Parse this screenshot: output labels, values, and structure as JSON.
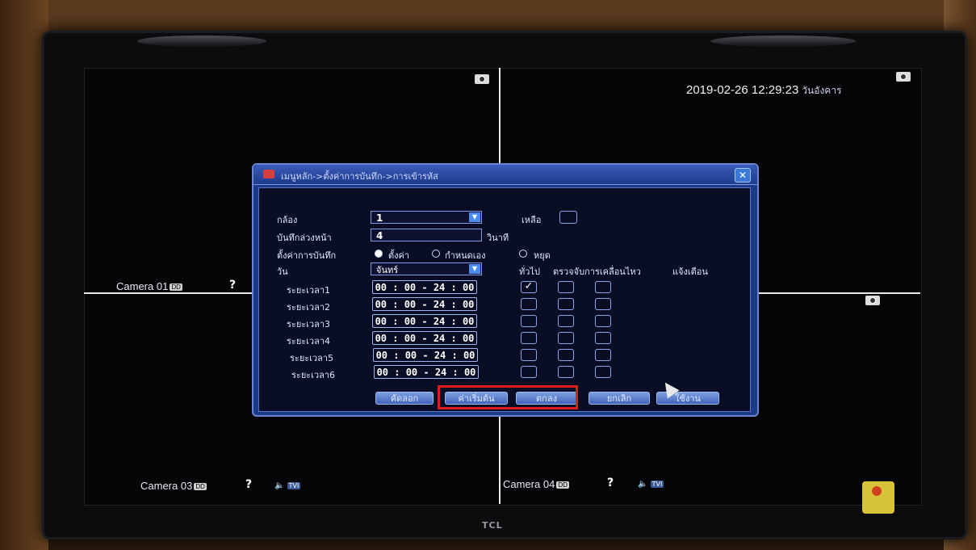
{
  "osd": {
    "datetime": "2019-02-26 12:29:23",
    "weekday": "วันอังคาร",
    "cameras": [
      {
        "label": "Camera 01",
        "badge": "DD"
      },
      {
        "label": "Camera 03",
        "badge": "DD",
        "tvi": "TVI"
      },
      {
        "label": "Camera 04",
        "badge": "DD",
        "tvi": "TVI"
      }
    ],
    "help_glyph": "?"
  },
  "dialog": {
    "title": "เมนูหลัก->ตั้งค่าการบันทึก->การเข้ารหัส",
    "close_glyph": "✕",
    "channel_label": "กล้อง",
    "channel_value": "1",
    "remaining_label": "เหลือ",
    "prerecord_label": "บันทึกล่วงหน้า",
    "prerecord_value": "4",
    "prerecord_unit": "วินาที",
    "record_mode_label": "ตั้งค่าการบันทึก",
    "record_modes": [
      "ตั้งค่า",
      "กำหนดเอง",
      "หยุด"
    ],
    "day_label": "วัน",
    "day_value": "จันทร์",
    "col_headers": [
      "ทั่วไป",
      "ตรวจจับการเคลื่อนไหว",
      "แจ้งเตือน"
    ],
    "periods": [
      {
        "label": "ระยะเวลา1",
        "time": "00 : 00 - 24 : 00",
        "general": true
      },
      {
        "label": "ระยะเวลา2",
        "time": "00 : 00 - 24 : 00",
        "general": false
      },
      {
        "label": "ระยะเวลา3",
        "time": "00 : 00 - 24 : 00",
        "general": false
      },
      {
        "label": "ระยะเวลา4",
        "time": "00 : 00 - 24 : 00",
        "general": false
      },
      {
        "label": "ระยะเวลา5",
        "time": "00 : 00 - 24 : 00",
        "general": false
      },
      {
        "label": "ระยะเวลา6",
        "time": "00 : 00 - 24 : 00",
        "general": false
      }
    ],
    "buttons": {
      "copy": "คัดลอก",
      "default": "ค่าเริ่มต้น",
      "ok": "ตกลง",
      "cancel": "ยกเลิก",
      "apply": "ใช้งาน"
    },
    "checkmark": "✓"
  },
  "bezel": {
    "brand": "TCL"
  },
  "colors": {
    "highlight": "#e01b1b",
    "dialog_bg": "#1b3b8a"
  }
}
